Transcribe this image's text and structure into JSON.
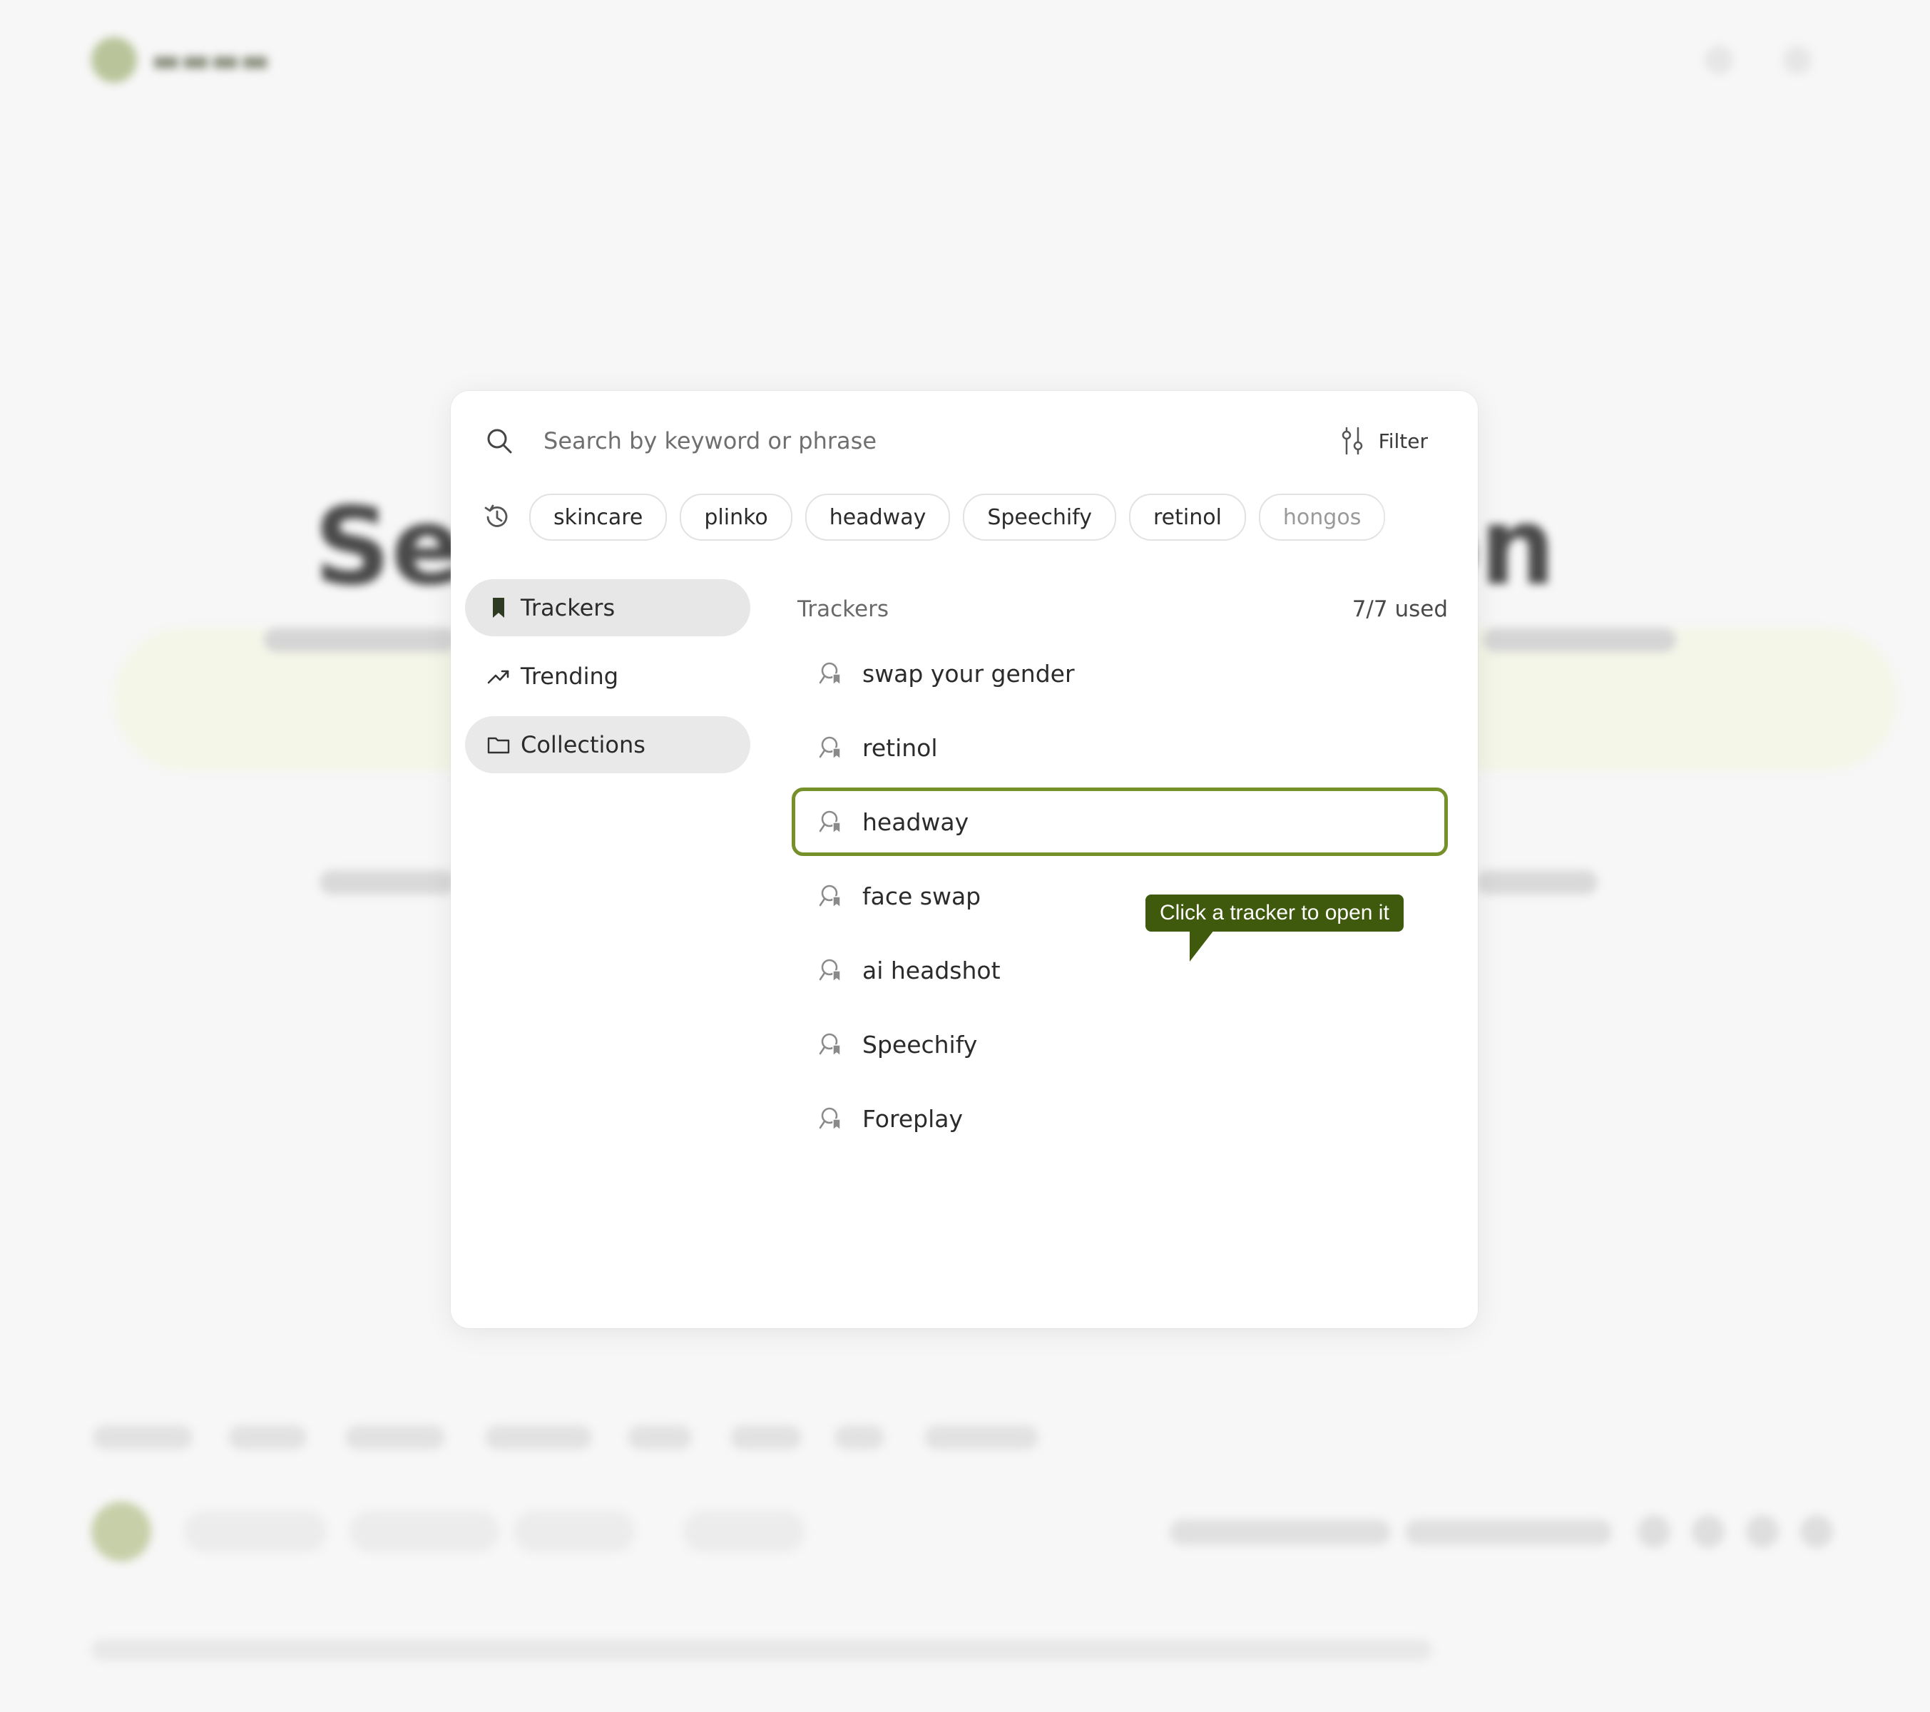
{
  "search": {
    "placeholder": "Search by keyword or phrase",
    "filter_label": "Filter"
  },
  "recent_searches": [
    "skincare",
    "plinko",
    "headway",
    "Speechify",
    "retinol",
    "hongos"
  ],
  "sidebar": {
    "items": [
      {
        "label": "Trackers",
        "icon": "bookmark-icon",
        "state": "active"
      },
      {
        "label": "Trending",
        "icon": "trending-icon",
        "state": "normal"
      },
      {
        "label": "Collections",
        "icon": "folder-icon",
        "state": "hover"
      }
    ]
  },
  "trackers": {
    "title": "Trackers",
    "usage": "7/7 used",
    "items": [
      "swap your gender",
      "retinol",
      "headway",
      "face swap",
      "ai headshot",
      "Speechify",
      "Foreplay"
    ],
    "selected": "headway"
  },
  "tooltip": {
    "text": "Click a tracker to open it"
  },
  "colors": {
    "accent": "#76902a",
    "tooltip_bg": "#3f5a0c",
    "active_nav_bg": "#e7e7e7"
  }
}
